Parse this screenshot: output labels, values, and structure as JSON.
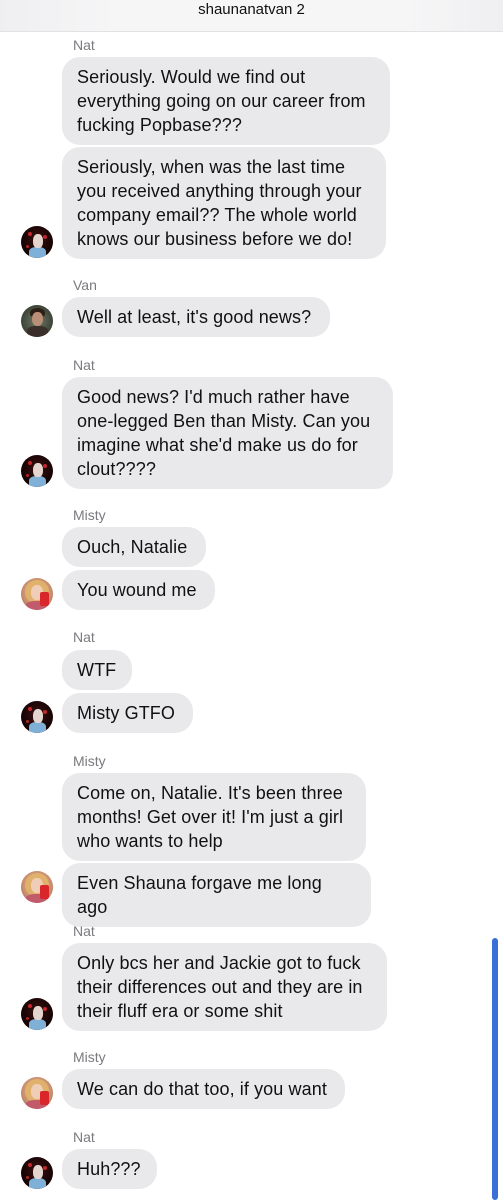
{
  "header": {
    "title": "shaunanatvan 2"
  },
  "messages": [
    {
      "sender": "Nat",
      "text": "Seriously. Would we find out\neverything going on our career from\nfucking Popbase???"
    },
    {
      "sender": "",
      "text": "Seriously, when was the last time\nyou received anything through your\ncompany email?? The whole world\nknows our business before we do!",
      "avatar": "nat"
    },
    {
      "sender": "Van",
      "text": "Well at least, it's good news?",
      "avatar": "van"
    },
    {
      "sender": "Nat",
      "text": "Good news? I'd much rather have\none-legged Ben than Misty. Can you\nimagine what she'd make us do for\nclout????",
      "avatar": "nat"
    },
    {
      "sender": "Misty",
      "text": "Ouch, Natalie"
    },
    {
      "sender": "",
      "text": "You wound me",
      "avatar": "misty"
    },
    {
      "sender": "Nat",
      "text": "WTF"
    },
    {
      "sender": "",
      "text": "Misty GTFO",
      "avatar": "nat"
    },
    {
      "sender": "Misty",
      "text": "Come on, Natalie. It's been three\nmonths! Get over it! I'm just a girl\nwho wants to help"
    },
    {
      "sender": "",
      "text": "Even Shauna forgave me long ago",
      "avatar": "misty"
    },
    {
      "sender": "Nat",
      "text": "Only bcs her and Jackie got to fuck\ntheir differences out and they are in\ntheir fluff era or some shit",
      "avatar": "nat"
    },
    {
      "sender": "Misty",
      "text": "We can do that too, if you want",
      "avatar": "misty"
    },
    {
      "sender": "Nat",
      "text": "Huh???",
      "avatar": "nat"
    }
  ],
  "colors": {
    "bubble": "#e9e9eb",
    "scrollbar": "#3a6fd8",
    "sender_label": "#7a7a7f"
  }
}
